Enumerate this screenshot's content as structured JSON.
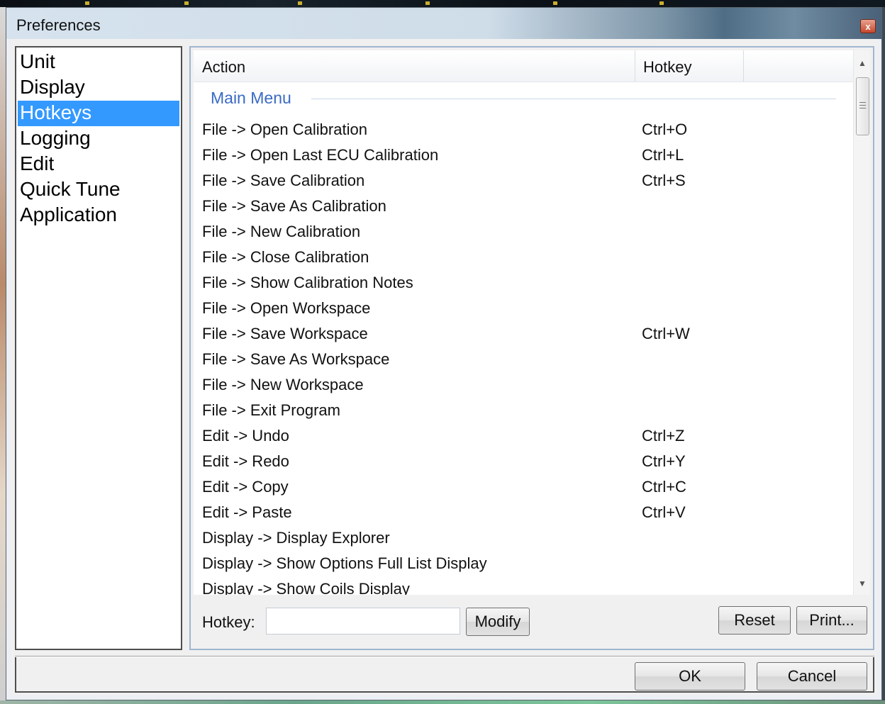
{
  "window": {
    "title": "Preferences",
    "close_glyph": "x"
  },
  "categories": [
    {
      "label": "Unit",
      "selected": false
    },
    {
      "label": "Display",
      "selected": false
    },
    {
      "label": "Hotkeys",
      "selected": true
    },
    {
      "label": "Logging",
      "selected": false
    },
    {
      "label": "Edit",
      "selected": false
    },
    {
      "label": "Quick Tune",
      "selected": false
    },
    {
      "label": "Application",
      "selected": false
    }
  ],
  "table": {
    "columns": [
      "Action",
      "Hotkey"
    ],
    "group": "Main Menu",
    "rows": [
      {
        "action": "File -> Open Calibration",
        "hotkey": "Ctrl+O"
      },
      {
        "action": "File -> Open Last ECU Calibration",
        "hotkey": "Ctrl+L"
      },
      {
        "action": "File -> Save Calibration",
        "hotkey": "Ctrl+S"
      },
      {
        "action": "File -> Save As Calibration",
        "hotkey": ""
      },
      {
        "action": "File -> New Calibration",
        "hotkey": ""
      },
      {
        "action": "File -> Close Calibration",
        "hotkey": ""
      },
      {
        "action": "File -> Show Calibration Notes",
        "hotkey": ""
      },
      {
        "action": "File -> Open Workspace",
        "hotkey": ""
      },
      {
        "action": "File -> Save Workspace",
        "hotkey": "Ctrl+W"
      },
      {
        "action": "File -> Save As Workspace",
        "hotkey": ""
      },
      {
        "action": "File -> New Workspace",
        "hotkey": ""
      },
      {
        "action": "File -> Exit Program",
        "hotkey": ""
      },
      {
        "action": "Edit -> Undo",
        "hotkey": "Ctrl+Z"
      },
      {
        "action": "Edit -> Redo",
        "hotkey": "Ctrl+Y"
      },
      {
        "action": "Edit -> Copy",
        "hotkey": "Ctrl+C"
      },
      {
        "action": "Edit -> Paste",
        "hotkey": "Ctrl+V"
      },
      {
        "action": "Display -> Display Explorer",
        "hotkey": ""
      },
      {
        "action": "Display -> Show Options Full List Display",
        "hotkey": ""
      },
      {
        "action": "Display -> Show Coils Display",
        "hotkey": ""
      }
    ]
  },
  "editor": {
    "hotkey_label": "Hotkey:",
    "hotkey_value": "",
    "modify_label": "Modify",
    "reset_label": "Reset",
    "print_label": "Print..."
  },
  "footer": {
    "ok_label": "OK",
    "cancel_label": "Cancel"
  },
  "icons": {
    "scroll_up": "scroll-up-arrow-icon",
    "scroll_down": "scroll-down-arrow-icon",
    "close": "close-icon"
  },
  "colors": {
    "selection": "#3399ff",
    "group_label": "#3a6bc4",
    "close_button": "#c7462c"
  }
}
